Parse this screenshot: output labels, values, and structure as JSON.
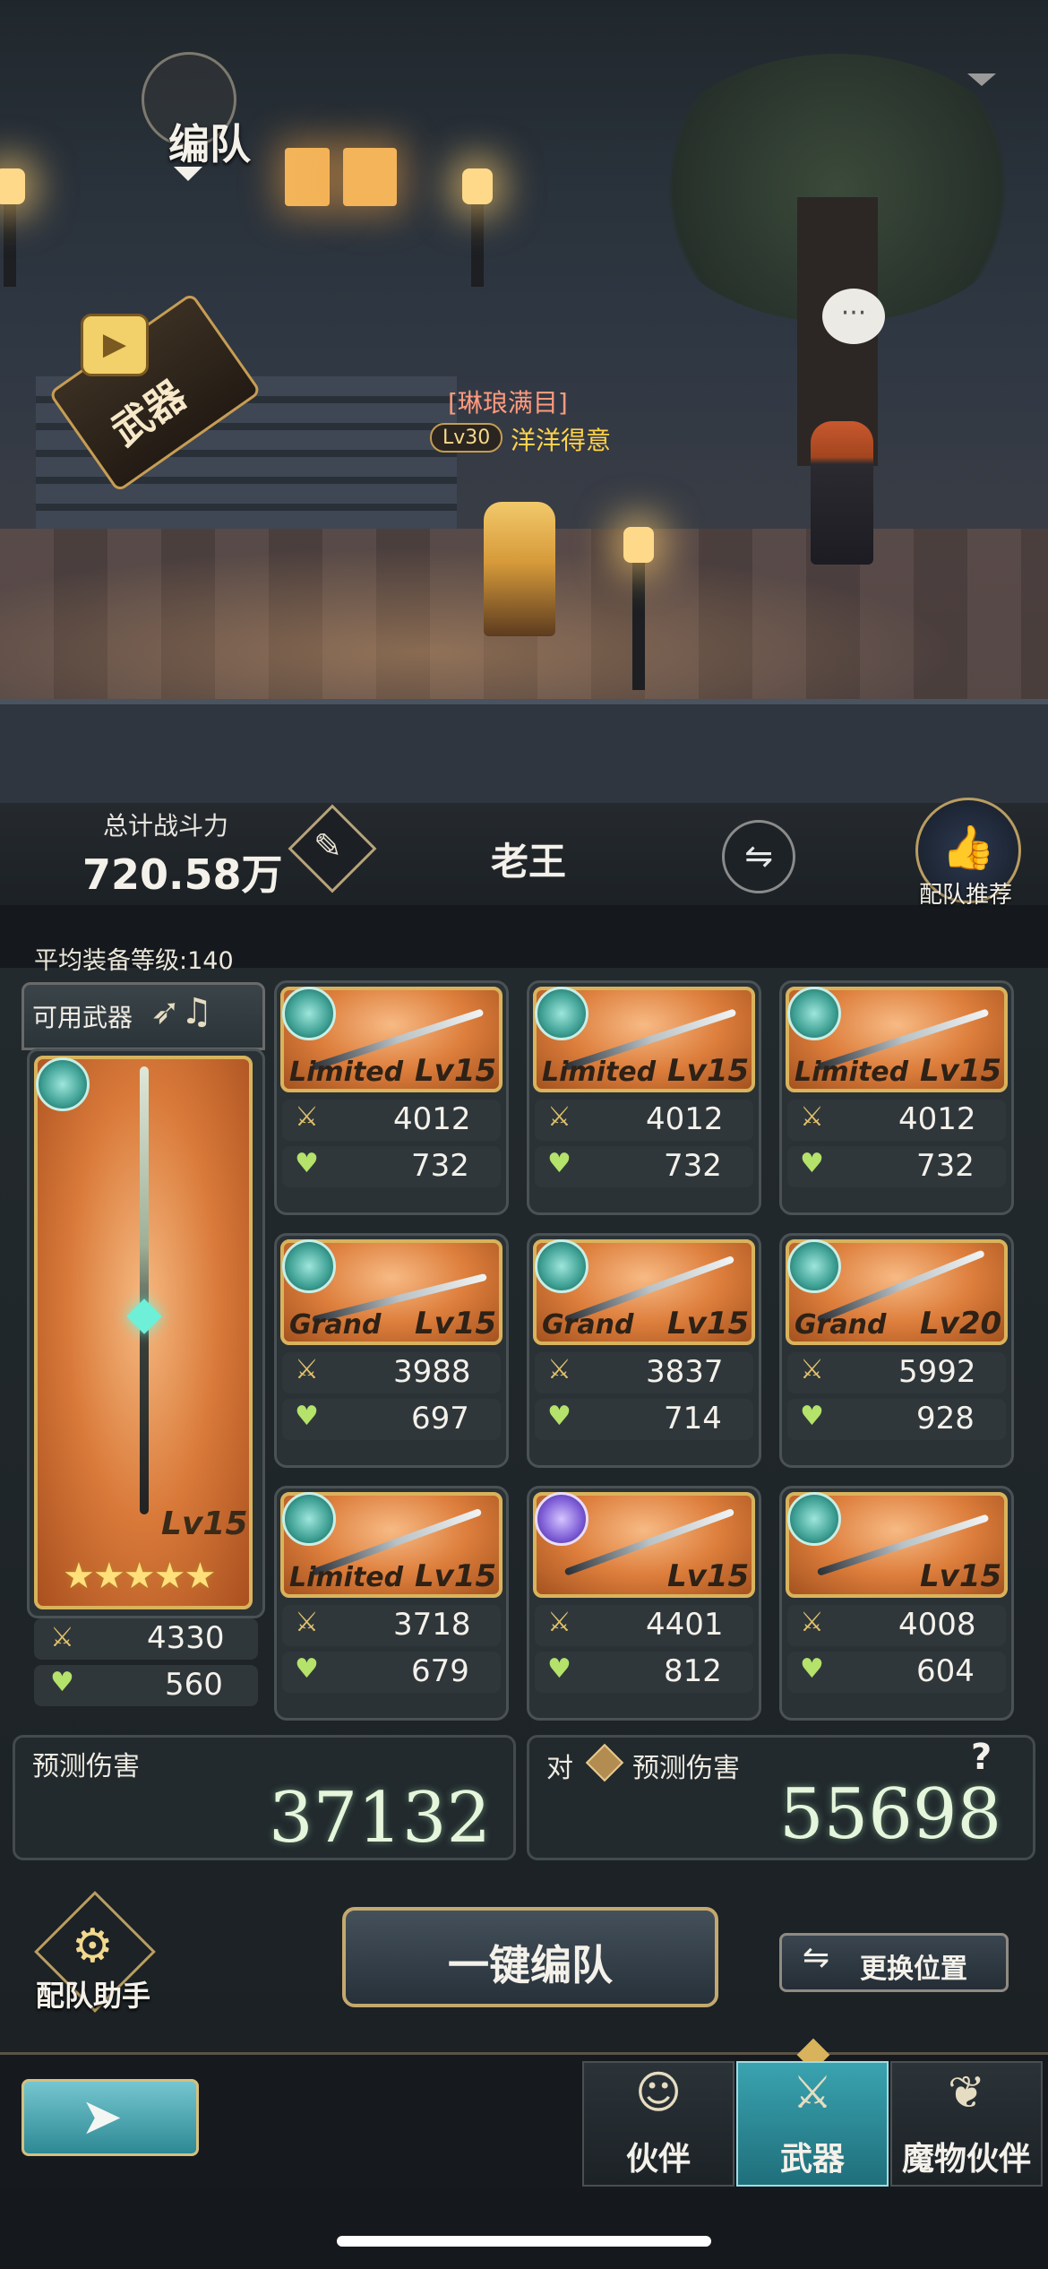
{
  "header": {
    "title": "编队",
    "weapon_badge": "武器"
  },
  "character": {
    "title": "[琳琅满目]",
    "level": "Lv30",
    "name": "洋洋得意"
  },
  "power": {
    "label": "总计战斗力",
    "value": "720.58万",
    "player_name": "老王",
    "recommend_label": "配队推荐"
  },
  "avg_level": "平均装备等级:140",
  "available_weapons_label": "可用武器",
  "featured_weapon": {
    "level": "Lv15",
    "stars": "★★★★★",
    "atk": "4330",
    "hp": "560"
  },
  "weapons": [
    {
      "tag": "Limited",
      "level": "Lv15",
      "atk": "4012",
      "hp": "732",
      "emblem": "teal"
    },
    {
      "tag": "Limited",
      "level": "Lv15",
      "atk": "4012",
      "hp": "732",
      "emblem": "teal"
    },
    {
      "tag": "Limited",
      "level": "Lv15",
      "atk": "4012",
      "hp": "732",
      "emblem": "teal"
    },
    {
      "tag": "Grand",
      "level": "Lv15",
      "atk": "3988",
      "hp": "697",
      "emblem": "teal"
    },
    {
      "tag": "Grand",
      "level": "Lv15",
      "atk": "3837",
      "hp": "714",
      "emblem": "teal"
    },
    {
      "tag": "Grand",
      "level": "Lv20",
      "atk": "5992",
      "hp": "928",
      "emblem": "teal"
    },
    {
      "tag": "Limited",
      "level": "Lv15",
      "atk": "3718",
      "hp": "679",
      "emblem": "teal"
    },
    {
      "tag": "",
      "level": "Lv15",
      "atk": "4401",
      "hp": "812",
      "emblem": "purple"
    },
    {
      "tag": "",
      "level": "Lv15",
      "atk": "4008",
      "hp": "604",
      "emblem": "teal"
    }
  ],
  "damage": {
    "left_label": "预测伤害",
    "left_value": "37132",
    "right_prefix": "对",
    "right_label": "预测伤害",
    "right_value": "55698",
    "help": "?"
  },
  "controls": {
    "assistant_label": "配队助手",
    "auto_label": "一键编队",
    "swap_position_label": "更换位置"
  },
  "nav": {
    "tabs": [
      {
        "label": "伙伴",
        "icon": "partner-icon"
      },
      {
        "label": "武器",
        "icon": "weapon-icon",
        "active": true
      },
      {
        "label": "魔物伙伴",
        "icon": "monster-icon"
      }
    ]
  },
  "colors": {
    "gold_border": "#d9b35c",
    "accent_teal": "#2d8994",
    "card_orange": "#dd7e3c"
  }
}
